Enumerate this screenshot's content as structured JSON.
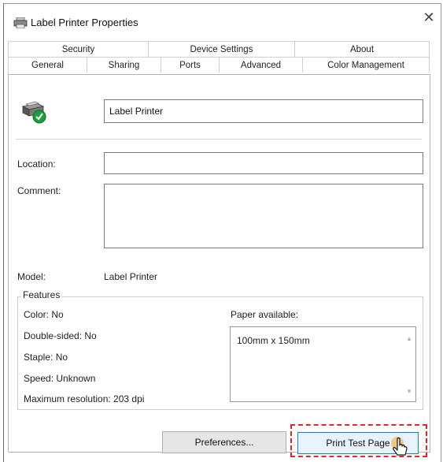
{
  "window": {
    "title": "Label Printer Properties",
    "close_glyph": "✕"
  },
  "tabs": {
    "back_row": [
      {
        "label": "Security"
      },
      {
        "label": "Device Settings"
      },
      {
        "label": "About"
      }
    ],
    "front_row": [
      {
        "label": "General",
        "selected": true
      },
      {
        "label": "Sharing"
      },
      {
        "label": "Ports"
      },
      {
        "label": "Advanced"
      },
      {
        "label": "Color Management"
      }
    ]
  },
  "general": {
    "printer_name": "Label Printer",
    "location": {
      "label": "Location:",
      "value": ""
    },
    "comment": {
      "label": "Comment:",
      "value": ""
    },
    "model": {
      "label": "Model:",
      "value": "Label Printer"
    },
    "features": {
      "title": "Features",
      "items": [
        "Color: No",
        "Double-sided: No",
        "Staple: No",
        "Speed: Unknown",
        "Maximum resolution: 203 dpi"
      ],
      "paper_label": "Paper available:",
      "paper_sizes": [
        "100mm x 150mm"
      ]
    }
  },
  "buttons": {
    "preferences": "Preferences...",
    "print_test_page": "Print Test Page"
  },
  "colors": {
    "highlight_dashes": "#d92b2b",
    "focus_border": "#1f78d1",
    "status_green": "#1e9e3a"
  },
  "icons": {
    "app": "printer-icon",
    "printer_large": "printer-ready-icon",
    "cursor": "hand-pointer-icon"
  }
}
